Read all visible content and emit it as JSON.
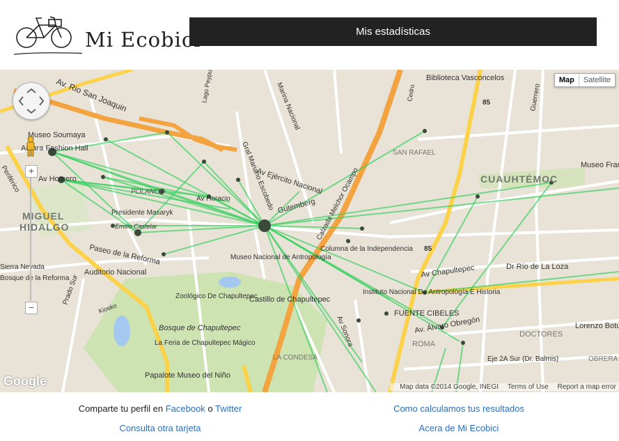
{
  "header": {
    "logo_text": "Mi Ecobici",
    "stats_button": "Mis estadísticas"
  },
  "map": {
    "type_map": "Map",
    "type_satellite": "Satellite",
    "zoom_in": "+",
    "zoom_out": "−",
    "google": "Google",
    "attribution": {
      "data": "Map data ©2014 Google, INEGI",
      "terms": "Terms of Use",
      "report": "Report a map error"
    },
    "labels": {
      "san_joaquin": "Av. Rio San Joaquin",
      "biblioteca": "Biblioteca Vasconcelos",
      "marina": "Marina Nacional",
      "soumaya": "Museo Soumaya",
      "antara": "Antara Fashion Hall",
      "perif": "Periférico",
      "homero": "Av Homero",
      "polanco": "POLANCO",
      "horacio": "Av Horacio",
      "masaryk": "Presidente Masaryk",
      "castelar": "Emilio Castelar",
      "miguel": "MIGUEL",
      "hidalgo": "HIDALGO",
      "reforma": "Paseo de la Reforma",
      "auditorio": "Auditorio Nacional",
      "antropologia": "Museo Nacional de Antropología",
      "ejercito": "Av Ejército Nacional",
      "gutemberg": "Gutemberg",
      "escobedo": "Gral Mariano Escobedo",
      "melchor": "Calzada Melchor Ocampo",
      "san_rafael": "SAN RAFAEL",
      "cuauhtemoc": "CUAUHTÉMOC",
      "museo_fr": "Museo Fran",
      "columna": "Columna de la Independencia",
      "chapultepec_av": "Av Chapultepec",
      "rio_loza": "Dr Río de La Loza",
      "zoo": "Zoológico De Chapultepec",
      "castillo": "Castillo de Chapultepec",
      "bosque": "Bosque de Chapultepec",
      "feria": "La Feria de Chapultepec Mágico",
      "papalote": "Papalote Museo del Niño",
      "condesa": "LA CONDESA",
      "sonora": "Av Sonora",
      "inah": "Instituto Nacional De Antropología E Historia",
      "cibeles": "FUENTE CIBELES",
      "obregon": "Av. Álvaro Obregón",
      "roma": "ROMA",
      "doctores": "DOCTORES",
      "lorenzo": "Lorenzo Botu",
      "eje2": "Eje 2A Sur (Dr. Balmis)",
      "obrera": "OBRERA",
      "kiosko": "Kiosko",
      "sierra": "Sierra Nevada",
      "bosque_reforma": "Bosque de la Reforma",
      "prado": "Prado Sur",
      "guerrero": "Guerrero",
      "cedro": "Cedro",
      "lago": "Lago Peypus",
      "r85a": "85",
      "r85b": "85"
    }
  },
  "footer": {
    "share_prefix": "Comparte tu perfil en ",
    "facebook": "Facebook",
    "or": " o ",
    "twitter": "Twitter",
    "how": "Como calculamos tus resultados",
    "other_card": "Consulta otra tarjeta",
    "about": "Acera de Mi Ecobici"
  },
  "colors": {
    "route": "#2fd05a",
    "header_bg": "#222222",
    "link": "#2a6ebb",
    "highway": "#f3a340"
  }
}
